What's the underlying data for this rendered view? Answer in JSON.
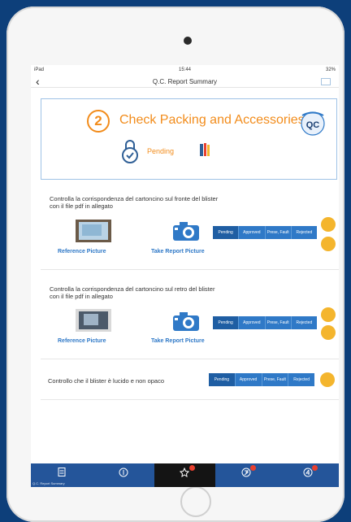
{
  "status_bar": {
    "carrier": "iPad",
    "time": "15:44",
    "battery": "32%"
  },
  "nav": {
    "back_symbol": "‹",
    "title": "Q.C. Report Summary"
  },
  "header": {
    "step_number": "2",
    "title": "Check Packing and Accessories",
    "status": "Pending",
    "brand_color": "#f28c1b"
  },
  "items": [
    {
      "text_line1": "Controlla la corrispondenza del cartoncino sul fronte del blister",
      "text_line2": "con il file pdf in allegato",
      "reference_label": "Reference Picture",
      "take_label": "Take Report Picture",
      "statuses": [
        "Pending",
        "Approved",
        "Prese, Fault",
        "Rejected"
      ],
      "selected": "Pending"
    },
    {
      "text_line1": "Controlla la corrispondenza del cartoncino sul retro del blister",
      "text_line2": "con il file pdf in allegato",
      "reference_label": "Reference Picture",
      "take_label": "Take Report Picture",
      "statuses": [
        "Pending",
        "Approved",
        "Prese, Fault",
        "Rejected"
      ],
      "selected": "Pending"
    },
    {
      "text_line1": "Controllo che il blister è lucido e non opaco",
      "statuses": [
        "Pending",
        "Approved",
        "Prese, Fault",
        "Rejected"
      ],
      "selected": "Pending"
    }
  ],
  "tabs": [
    {
      "label": "Q.C. Report Summary",
      "icon": "document-icon"
    },
    {
      "label": "",
      "icon": "step-1-icon"
    },
    {
      "label": "",
      "icon": "step-2-icon"
    },
    {
      "label": "",
      "icon": "step-3-icon"
    },
    {
      "label": "",
      "icon": "step-4-icon"
    }
  ],
  "colors": {
    "accent": "#2f79c7",
    "tabbar": "#24559a",
    "pending": "#f28c1b"
  }
}
